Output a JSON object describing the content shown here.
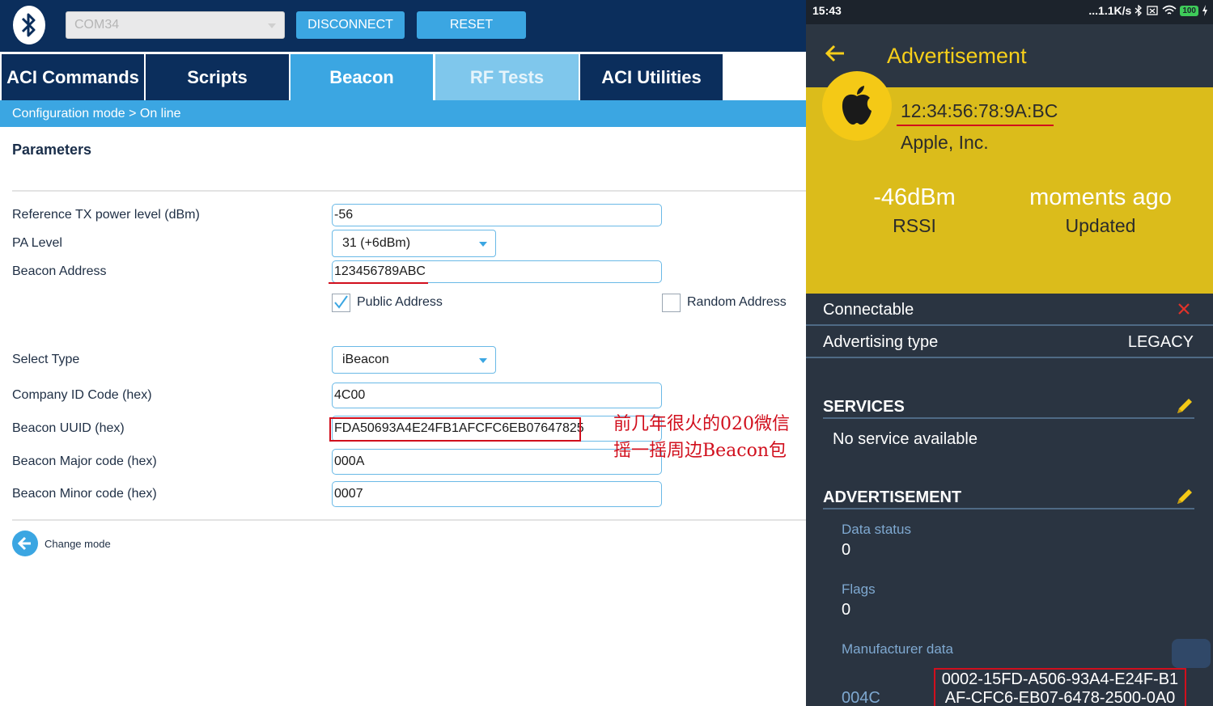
{
  "left_app": {
    "com_port": "COM34",
    "disconnect": "DISCONNECT",
    "reset": "RESET",
    "tabs": [
      {
        "label": "ACI Commands"
      },
      {
        "label": "Scripts"
      },
      {
        "label": "Beacon"
      },
      {
        "label": "RF Tests"
      },
      {
        "label": "ACI Utilities"
      }
    ],
    "breadcrumb": "Configuration mode  > On line",
    "params_title": "Parameters",
    "fields": {
      "tx_power_label": "Reference TX power level (dBm)",
      "tx_power_value": "-56",
      "pa_level_label": "PA Level",
      "pa_level_value": "31 (+6dBm)",
      "beacon_address_label": "Beacon Address",
      "beacon_address_value": "123456789ABC",
      "public_address_label": "Public Address",
      "random_address_label": "Random Address",
      "select_type_label": "Select Type",
      "select_type_value": "iBeacon",
      "company_id_label": "Company ID Code (hex)",
      "company_id_value": "4C00",
      "uuid_label": "Beacon UUID (hex)",
      "uuid_value": "FDA50693A4E24FB1AFCFC6EB07647825",
      "major_label": "Beacon Major code (hex)",
      "major_value": "000A",
      "minor_label": "Beacon Minor code (hex)",
      "minor_value": "0007"
    },
    "public_checked": true,
    "random_checked": false,
    "change_mode": "Change mode",
    "annotation_line1": "前几年很火的020微信",
    "annotation_line2": "摇一摇周边Beacon包"
  },
  "phone": {
    "time": "15:43",
    "net_speed": "...1.1K/s",
    "battery": "100",
    "title": "Advertisement",
    "mac": "12:34:56:78:9A:BC",
    "company": "Apple, Inc.",
    "rssi_value": "-46dBm",
    "rssi_label": "RSSI",
    "updated_value": "moments ago",
    "updated_label": "Updated",
    "connectable_label": "Connectable",
    "adv_type_label": "Advertising type",
    "adv_type_value": "LEGACY",
    "services_title": "SERVICES",
    "services_text": "No service available",
    "advertisement_title": "ADVERTISEMENT",
    "data_status_label": "Data status",
    "data_status_value": "0",
    "flags_label": "Flags",
    "flags_value": "0",
    "manufacturer_label": "Manufacturer data",
    "manufacturer_id": "004C",
    "manufacturer_line1": "0002-15FD-A506-93A4-E24F-B1",
    "manufacturer_line2": "AF-CFC6-EB07-6478-2500-0A0",
    "colors": {
      "accent": "#3ba6e2",
      "navy": "#0b2e5c",
      "yellow": "#dbbc1b",
      "title_yellow": "#f7cf1a",
      "red": "#d10f1d"
    }
  }
}
